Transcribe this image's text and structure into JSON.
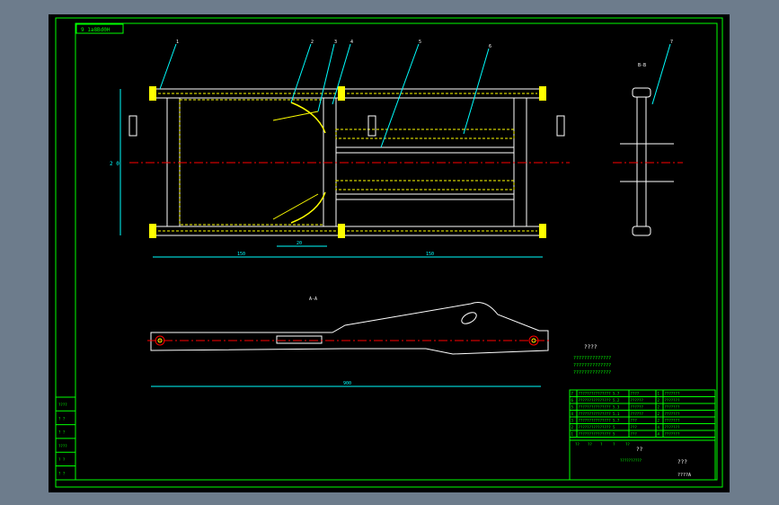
{
  "colors": {
    "background": "#000000",
    "window": "#6d7c8c",
    "frame": "#00ff00",
    "part": "#ffffff",
    "hidden_line": "#ffff00",
    "dimension": "#00ffff",
    "centerline": "#ff0000",
    "leader": "#00ffff",
    "hatch_fill": "#ffff00"
  },
  "drawing": {
    "title_tag": "9 1a8Bd0H",
    "view_bb": "B-B",
    "view_aa": "A-A",
    "dim_left_height": "2 0",
    "dim_bottom_left": "150",
    "dim_bottom_right": "150",
    "dim_mid": "20",
    "dim_long": "900",
    "tech_heading": "????",
    "tech_lines": [
      "??????????????",
      "??????????????",
      "??????????????"
    ]
  },
  "balloons": [
    "1",
    "2",
    "3",
    "4",
    "5",
    "6",
    "7"
  ],
  "parts_list": [
    {
      "no": "7",
      "code": "??????????????? 5.7",
      "name": "????",
      "qty": "1",
      "mat": "???????"
    },
    {
      "no": "6",
      "code": "??????????????? 5.2",
      "name": "??????",
      "qty": "2",
      "mat": "???????"
    },
    {
      "no": "5",
      "code": "??????????????? 5.3",
      "name": "??????",
      "qty": "2",
      "mat": "???????"
    },
    {
      "no": "4",
      "code": "??????????????? 5.1",
      "name": "??????",
      "qty": "2",
      "mat": "???????"
    },
    {
      "no": "3",
      "code": "??????????????? 5.7",
      "name": "???",
      "qty": "2",
      "mat": "???????"
    },
    {
      "no": "2",
      "code": "??????????????? 5",
      "name": "???",
      "qty": "4",
      "mat": "???????"
    },
    {
      "no": "1",
      "code": "??????????????? 5",
      "name": "???",
      "qty": "4",
      "mat": "???????"
    }
  ],
  "title_block": {
    "header": [
      "??",
      "??",
      "?",
      "?",
      "??"
    ],
    "project": "??",
    "part_name": "???",
    "drawing_no": "??????????",
    "sheet": "????A"
  },
  "left_strip": [
    "????",
    "? ?",
    "? ?",
    "????",
    "? ?",
    "? ?"
  ]
}
